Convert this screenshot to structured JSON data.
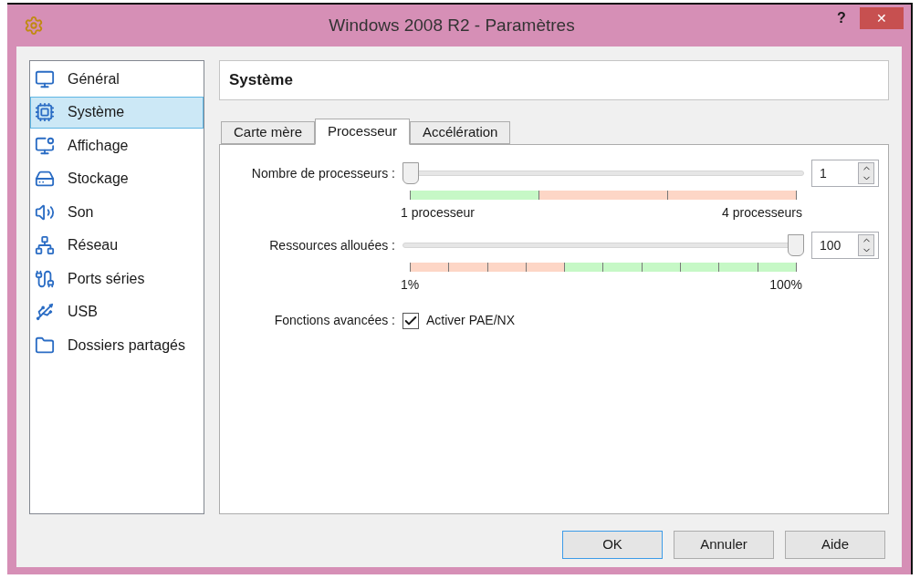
{
  "window": {
    "title": "Windows 2008 R2 - Paramètres",
    "help_button": "?",
    "close_button": "✕"
  },
  "sidebar": {
    "items": [
      {
        "label": "Général",
        "selected": false
      },
      {
        "label": "Système",
        "selected": true
      },
      {
        "label": "Affichage",
        "selected": false
      },
      {
        "label": "Stockage",
        "selected": false
      },
      {
        "label": "Son",
        "selected": false
      },
      {
        "label": "Réseau",
        "selected": false
      },
      {
        "label": "Ports séries",
        "selected": false
      },
      {
        "label": "USB",
        "selected": false
      },
      {
        "label": "Dossiers partagés",
        "selected": false
      }
    ]
  },
  "page_title": "Système",
  "tabs": [
    {
      "label": "Carte mère",
      "selected": false
    },
    {
      "label": "Processeur",
      "selected": true
    },
    {
      "label": "Accélération",
      "selected": false
    }
  ],
  "rows": [
    {
      "kind": "slider",
      "label": "Nombre de processeurs :",
      "level": 0,
      "value": "1",
      "min_label": "1 processeur",
      "max_label": "4 processeurs",
      "segments": [
        {
          "color": "#c6f8c6"
        },
        {
          "color": "#fdd6c6"
        },
        {
          "color": "#fdd6c6"
        }
      ]
    },
    {
      "kind": "slider",
      "label": "Ressources allouées :",
      "level": 1,
      "value": "100",
      "min_label": "1%",
      "max_label": "100%",
      "segments": [
        {
          "color": "#fdd6c6"
        },
        {
          "color": "#fdd6c6"
        },
        {
          "color": "#fdd6c6"
        },
        {
          "color": "#fdd6c6"
        },
        {
          "color": "#c6f8c6"
        },
        {
          "color": "#c6f8c6"
        },
        {
          "color": "#c6f8c6"
        },
        {
          "color": "#c6f8c6"
        },
        {
          "color": "#c6f8c6"
        },
        {
          "color": "#c6f8c6"
        }
      ]
    },
    {
      "kind": "checkbox",
      "label": "Fonctions avancées :",
      "option": "Activer PAE/NX",
      "checked": true
    }
  ],
  "buttons": [
    {
      "label": "OK",
      "default": true
    },
    {
      "label": "Annuler",
      "default": false
    },
    {
      "label": "Aide",
      "default": false
    }
  ]
}
